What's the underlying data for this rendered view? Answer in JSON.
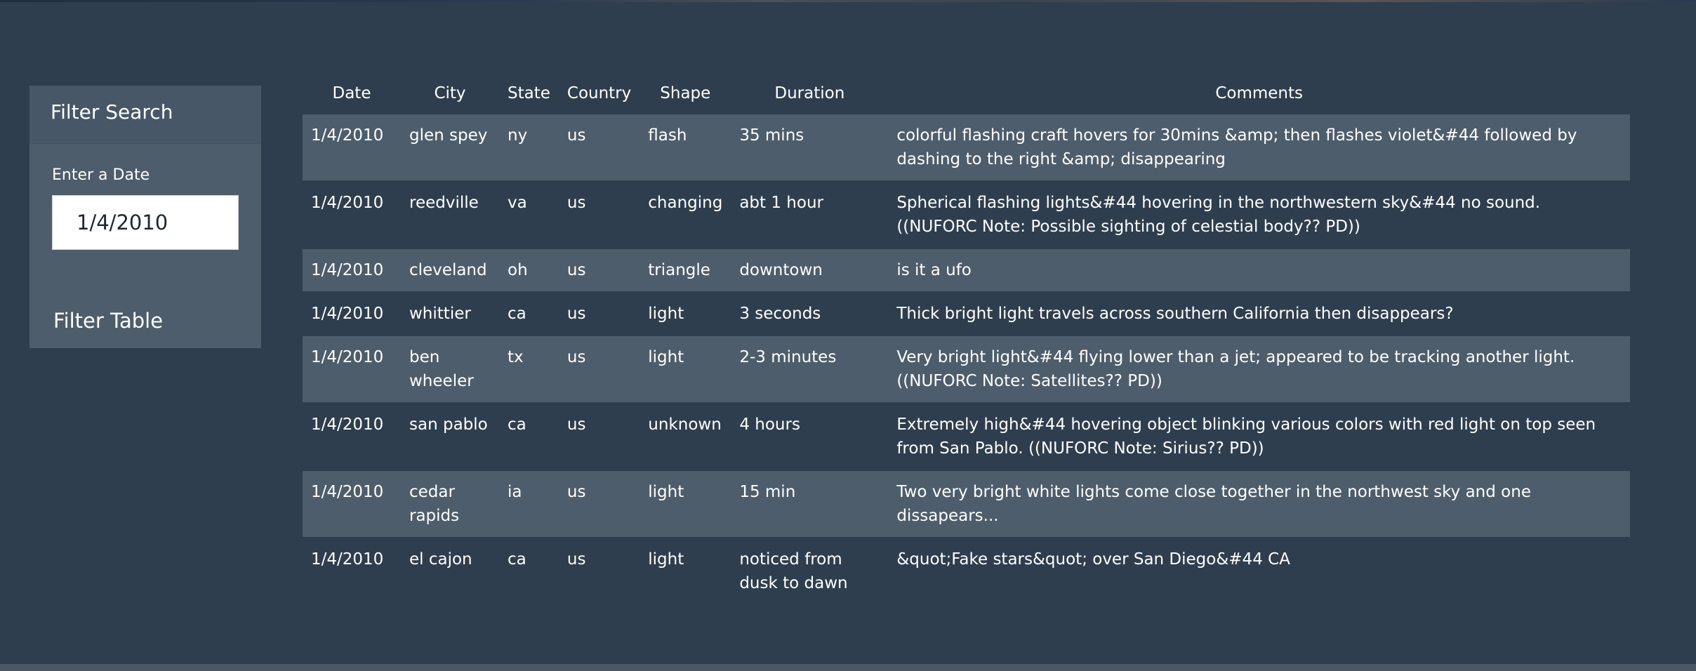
{
  "filter": {
    "title": "Filter Search",
    "date_label": "Enter a Date",
    "date_value": "1/4/2010",
    "button_label": "Filter Table"
  },
  "table": {
    "headers": [
      "Date",
      "City",
      "State",
      "Country",
      "Shape",
      "Duration",
      "Comments"
    ],
    "rows": [
      [
        "1/4/2010",
        "glen spey",
        "ny",
        "us",
        "flash",
        "35 mins",
        "colorful flashing craft hovers for 30mins &amp; then flashes violet&#44 followed by dashing to the right &amp; disappearing"
      ],
      [
        "1/4/2010",
        "reedville",
        "va",
        "us",
        "changing",
        "abt 1 hour",
        "Spherical flashing lights&#44 hovering in the northwestern sky&#44 no sound. ((NUFORC Note: Possible sighting of celestial body?? PD))"
      ],
      [
        "1/4/2010",
        "cleveland",
        "oh",
        "us",
        "triangle",
        "downtown",
        "is it a ufo"
      ],
      [
        "1/4/2010",
        "whittier",
        "ca",
        "us",
        "light",
        "3 seconds",
        "Thick bright light travels across southern California then disappears?"
      ],
      [
        "1/4/2010",
        "ben wheeler",
        "tx",
        "us",
        "light",
        "2-3 minutes",
        "Very bright light&#44 flying lower than a jet; appeared to be tracking another light. ((NUFORC Note: Satellites?? PD))"
      ],
      [
        "1/4/2010",
        "san pablo",
        "ca",
        "us",
        "unknown",
        "4 hours",
        "Extremely high&#44 hovering object blinking various colors with red light on top seen from San Pablo. ((NUFORC Note: Sirius?? PD))"
      ],
      [
        "1/4/2010",
        "cedar rapids",
        "ia",
        "us",
        "light",
        "15 min",
        "Two very bright white lights come close together in the northwest sky and one dissapears..."
      ],
      [
        "1/4/2010",
        "el cajon",
        "ca",
        "us",
        "light",
        "noticed from dusk to dawn",
        "&quot;Fake stars&quot; over San Diego&#44 CA"
      ]
    ]
  }
}
